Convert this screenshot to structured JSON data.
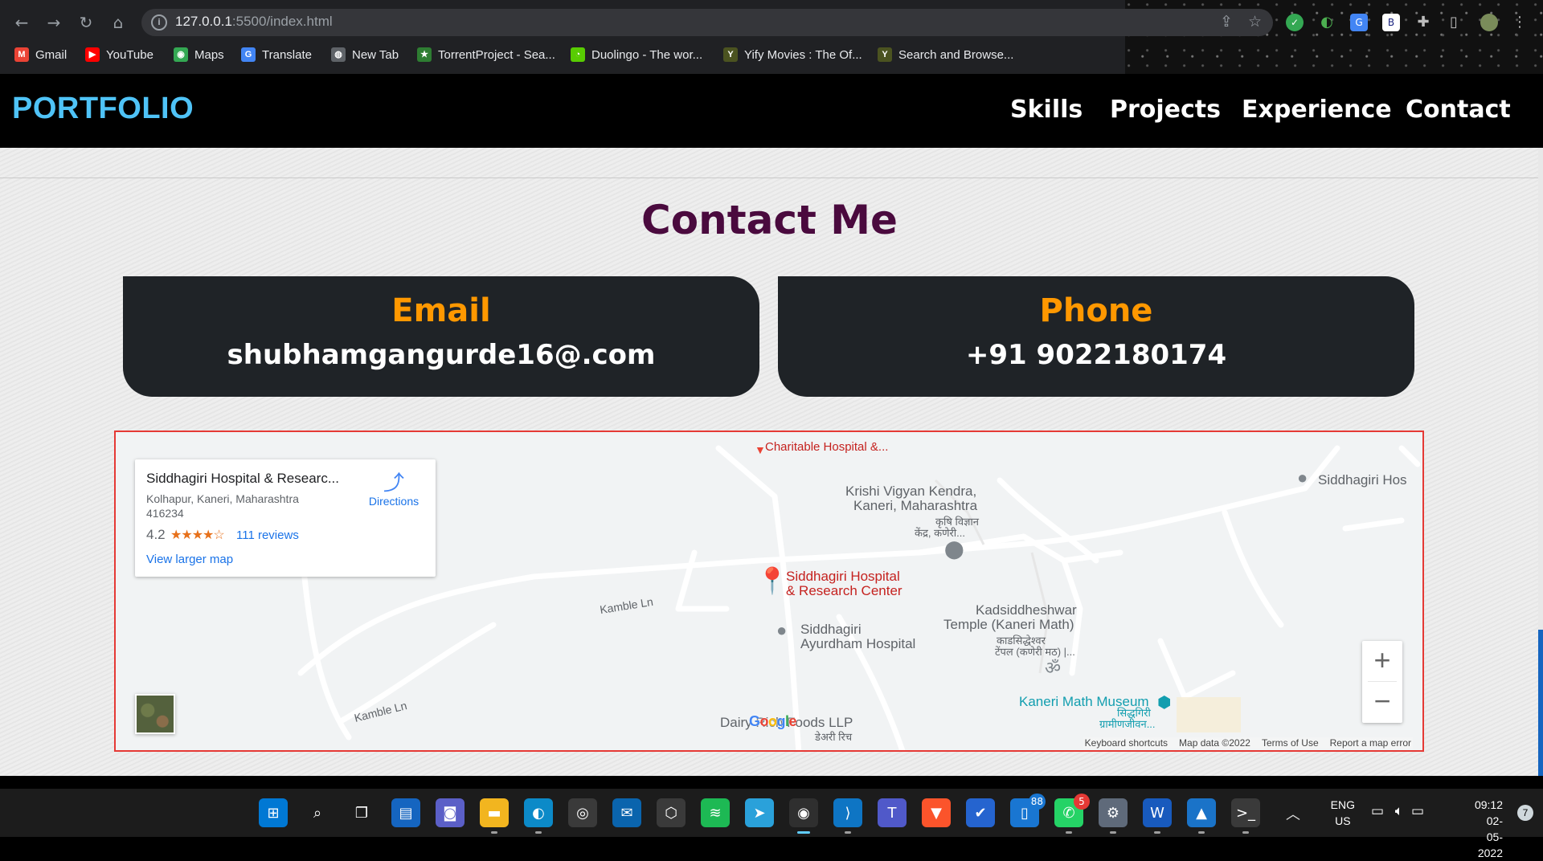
{
  "browser": {
    "url_host": "127.0.0.1",
    "url_rest": ":5500/index.html",
    "bookmarks": [
      {
        "label": "Gmail",
        "icon": "gmail-icon",
        "color": "#ea4335",
        "glyph": "M"
      },
      {
        "label": "YouTube",
        "icon": "youtube-icon",
        "color": "#ff0000",
        "glyph": "▶"
      },
      {
        "label": "Maps",
        "icon": "maps-icon",
        "color": "#34a853",
        "glyph": "◉"
      },
      {
        "label": "Translate",
        "icon": "translate-icon",
        "color": "#4285f4",
        "glyph": "G"
      },
      {
        "label": "New Tab",
        "icon": "globe-icon",
        "color": "#5f6368",
        "glyph": "◍"
      },
      {
        "label": "TorrentProject - Sea...",
        "icon": "torrentproject-icon",
        "color": "#2e7d32",
        "glyph": "★"
      },
      {
        "label": "Duolingo - The wor...",
        "icon": "duolingo-icon",
        "color": "#58cc02",
        "glyph": "◔"
      },
      {
        "label": "Yify Movies : The Of...",
        "icon": "yify-icon",
        "color": "#4b5320",
        "glyph": "Y"
      },
      {
        "label": "Search and Browse...",
        "icon": "yify-search-icon",
        "color": "#4b5320",
        "glyph": "Y"
      }
    ]
  },
  "nav": {
    "brand": "PORTFOLIO",
    "links": [
      "Skills",
      "Projects",
      "Experience",
      "Contact"
    ]
  },
  "contact": {
    "title": "Contact Me",
    "email_label": "Email",
    "email_value": "shubhamgangurde16@.com",
    "phone_label": "Phone",
    "phone_value": "+91 9022180174"
  },
  "map": {
    "card_title": "Siddhagiri Hospital & Researc...",
    "card_address": "Kolhapur, Kaneri, Maharashtra 416234",
    "rating": "4.2",
    "stars": "★★★★☆",
    "reviews": "111 reviews",
    "larger_map": "View larger map",
    "directions": "Directions",
    "labels": {
      "charitable": "Charitable Hospital &...",
      "krishi": "Krishi Vigyan Kendra,",
      "krishi2": "Kaneri, Maharashtra",
      "krishi_mr": "कृषि विज्ञान",
      "krishi_mr2": "केंद्र, कणेरी...",
      "siddhagiri_hos": "Siddhagiri Hos",
      "hospital": "Siddhagiri Hospital",
      "hospital2": "& Research Center",
      "kamble1": "Kamble Ln",
      "kamble2": "Kamble Ln",
      "ayurdham": "Siddhagiri",
      "ayurdham2": "Ayurdham Hospital",
      "kadsiddheshwar": "Kadsiddheshwar",
      "kadsiddheshwar2": "Temple (Kaneri Math)",
      "kad_mr": "काडसिद्धेश्वर",
      "kad_mr2": "टेंपल (कणेरी मठ) |...",
      "museum": "Kaneri Math Museum",
      "museum_mr": "सिद्धगिरी",
      "museum_mr2": "ग्रामीणजीवन...",
      "dairy": "Dairy Rich Foods LLP",
      "dairy_mr": "डेअरी रिच"
    },
    "google": "Google",
    "footer": [
      "Keyboard shortcuts",
      "Map data ©2022",
      "Terms of Use",
      "Report a map error"
    ],
    "zoom_in": "+",
    "zoom_out": "−"
  },
  "taskbar": {
    "apps": [
      {
        "name": "start-button",
        "glyph": "⊞",
        "color": "#0078d4"
      },
      {
        "name": "search-button",
        "glyph": "⌕",
        "color": "transparent"
      },
      {
        "name": "task-view-button",
        "glyph": "❐",
        "color": "transparent"
      },
      {
        "name": "widgets-button",
        "glyph": "▤",
        "color": "#1565c0"
      },
      {
        "name": "teams-chat-button",
        "glyph": "◙",
        "color": "#5b5fc7"
      },
      {
        "name": "file-explorer-button",
        "glyph": "▬",
        "color": "#f2b51f"
      },
      {
        "name": "edge-button",
        "glyph": "◐",
        "color": "#0c8ac8"
      },
      {
        "name": "obs-button",
        "glyph": "◎",
        "color": "#3a3a3a"
      },
      {
        "name": "mail-button",
        "glyph": "✉",
        "color": "#0a64ad"
      },
      {
        "name": "unity-button",
        "glyph": "⬡",
        "color": "#3a3a3a"
      },
      {
        "name": "spotify-button",
        "glyph": "≋",
        "color": "#1db954"
      },
      {
        "name": "telegram-button",
        "glyph": "➤",
        "color": "#2aa1da"
      },
      {
        "name": "chrome-button",
        "glyph": "◉",
        "color": "#2f2f2f"
      },
      {
        "name": "vscode-button",
        "glyph": "⟩",
        "color": "#0e75c4"
      },
      {
        "name": "teams-button",
        "glyph": "T",
        "color": "#5059c9"
      },
      {
        "name": "brave-button",
        "glyph": "▼",
        "color": "#fb542b"
      },
      {
        "name": "todo-button",
        "glyph": "✔",
        "color": "#2564cf"
      },
      {
        "name": "phone-link-button",
        "glyph": "▯",
        "color": "#1976d2"
      },
      {
        "name": "whatsapp-button",
        "glyph": "✆",
        "color": "#25d366"
      },
      {
        "name": "settings-button",
        "glyph": "⚙",
        "color": "#5f6a7a"
      },
      {
        "name": "word-button",
        "glyph": "W",
        "color": "#185abd"
      },
      {
        "name": "photos-button",
        "glyph": "▲",
        "color": "#1a73c8"
      },
      {
        "name": "terminal-button",
        "glyph": ">_",
        "color": "#3a3a3a"
      }
    ],
    "phone_link_badge": "88",
    "whatsapp_badge": "5",
    "lang": "ENG",
    "region": "US",
    "time": "09:12",
    "date": "02-05-2022",
    "notifications": "7"
  }
}
